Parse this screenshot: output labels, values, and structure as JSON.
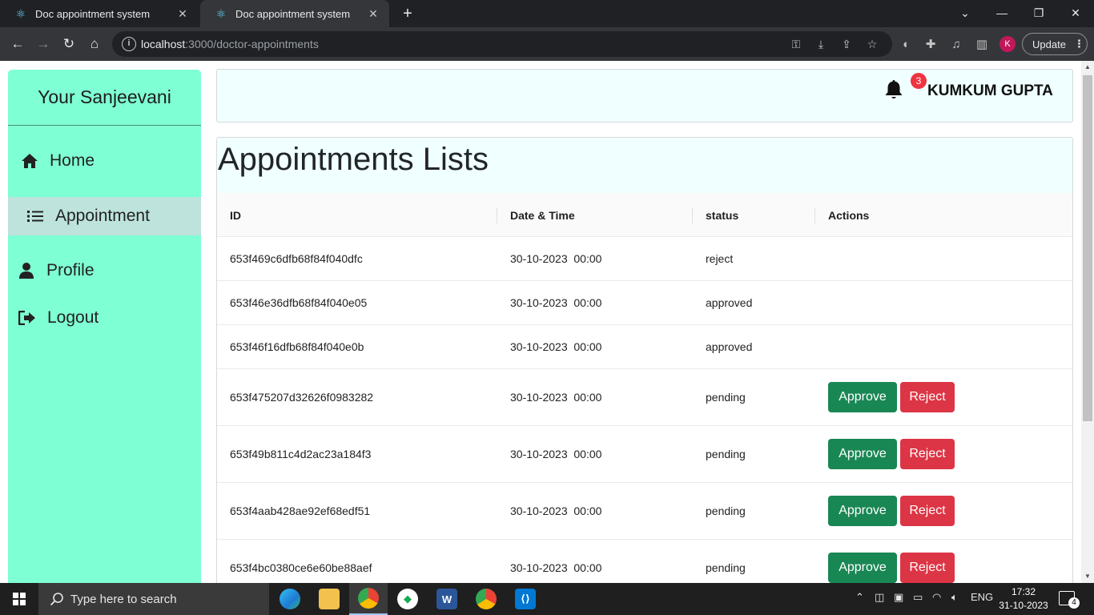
{
  "browser": {
    "tabs": [
      {
        "title": "Doc appointment system"
      },
      {
        "title": "Doc appointment system"
      }
    ],
    "url_host": "localhost",
    "url_path": ":3000/doctor-appointments",
    "update_label": "Update",
    "profile_initial": "K"
  },
  "sidebar": {
    "brand": "Your Sanjeevani",
    "items": [
      {
        "label": "Home",
        "icon": "house-icon"
      },
      {
        "label": "Appointment",
        "icon": "list-icon"
      },
      {
        "label": "Profile",
        "icon": "user-icon"
      },
      {
        "label": "Logout",
        "icon": "logout-icon"
      }
    ],
    "active_index": 1,
    "bg_color": "#7fffd4"
  },
  "header": {
    "notification_count": "3",
    "user_name": "KUMKUM GUPTA"
  },
  "main": {
    "title": "Appointments Lists",
    "columns": [
      "ID",
      "Date & Time",
      "status",
      "Actions"
    ],
    "rows": [
      {
        "id": "653f469c6dfb68f84f040dfc",
        "datetime": "30-10-2023  00:00",
        "status": "reject"
      },
      {
        "id": "653f46e36dfb68f84f040e05",
        "datetime": "30-10-2023  00:00",
        "status": "approved"
      },
      {
        "id": "653f46f16dfb68f84f040e0b",
        "datetime": "30-10-2023  00:00",
        "status": "approved"
      },
      {
        "id": "653f475207d32626f0983282",
        "datetime": "30-10-2023  00:00",
        "status": "pending"
      },
      {
        "id": "653f49b811c4d2ac23a184f3",
        "datetime": "30-10-2023  00:00",
        "status": "pending"
      },
      {
        "id": "653f4aab428ae92ef68edf51",
        "datetime": "30-10-2023  00:00",
        "status": "pending"
      },
      {
        "id": "653f4bc0380ce6e60be88aef",
        "datetime": "30-10-2023  00:00",
        "status": "pending"
      }
    ],
    "approve_label": "Approve",
    "reject_label": "Reject",
    "approve_color": "#198754",
    "reject_color": "#dc3545"
  },
  "taskbar": {
    "search_placeholder": "Type here to search",
    "language": "ENG",
    "time": "17:32",
    "date": "31-10-2023",
    "notification_count": "4"
  }
}
